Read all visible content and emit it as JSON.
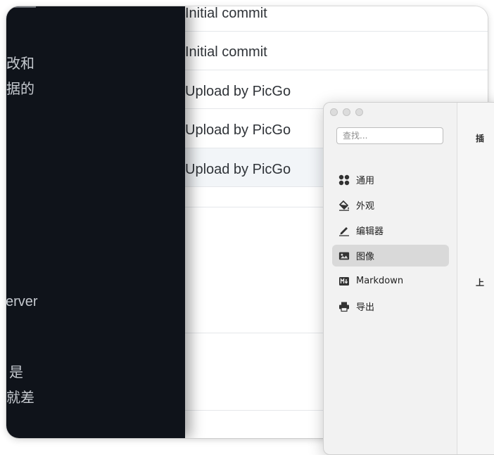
{
  "left_panel": {
    "lines": [
      "改和",
      "据的",
      "erver",
      "是",
      "就差"
    ]
  },
  "commits": [
    {
      "message": "Initial commit"
    },
    {
      "message": "Initial commit"
    },
    {
      "message": "Upload by PicGo"
    },
    {
      "message": "Upload by PicGo"
    },
    {
      "message": "Upload by PicGo"
    }
  ],
  "preferences": {
    "search": {
      "placeholder": "查找..."
    },
    "sidebar": {
      "items": [
        {
          "label": "通用",
          "icon": "grid-icon"
        },
        {
          "label": "外观",
          "icon": "paint-bucket-icon"
        },
        {
          "label": "编辑器",
          "icon": "pencil-icon"
        },
        {
          "label": "图像",
          "icon": "image-icon",
          "active": true
        },
        {
          "label": "Markdown",
          "icon": "markdown-icon"
        },
        {
          "label": "导出",
          "icon": "printer-icon"
        }
      ]
    },
    "right_pane": {
      "char_top": "插",
      "char_mid": "上"
    }
  },
  "colors": {
    "dark_panel": "#0f131a",
    "active_item": "#d9d9d9",
    "highlight_row": "#f2f5f8"
  }
}
